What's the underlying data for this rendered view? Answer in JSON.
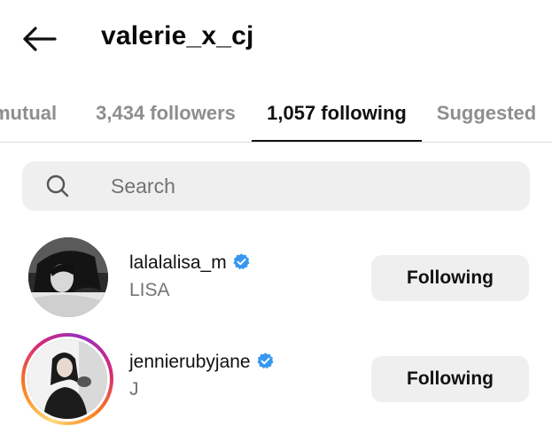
{
  "header": {
    "title": "valerie_x_cj"
  },
  "tabs": [
    {
      "label": "mutual"
    },
    {
      "label": "3,434 followers"
    },
    {
      "label": "1,057 following"
    },
    {
      "label": "Suggested"
    }
  ],
  "search": {
    "placeholder": "Search"
  },
  "accounts": [
    {
      "username": "lalalalisa_m",
      "full_name": "LISA",
      "verified": true,
      "button_label": "Following",
      "has_story_ring": false
    },
    {
      "username": "jennierubyjane",
      "full_name": "J",
      "verified": true,
      "button_label": "Following",
      "has_story_ring": true
    }
  ],
  "colors": {
    "verified_badge": "#3897f0",
    "button_bg": "#efefef",
    "muted_text": "#737373",
    "inactive_tab": "#8e8e8e"
  }
}
